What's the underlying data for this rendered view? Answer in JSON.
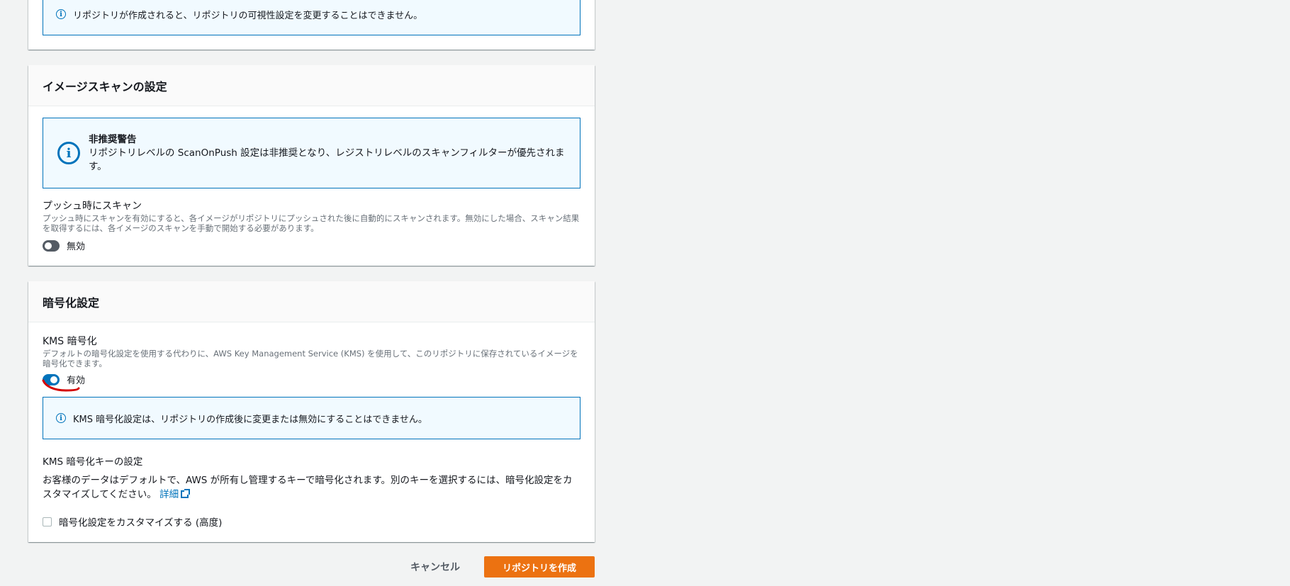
{
  "visibility_notice": {
    "text": "リポジトリが作成されると、リポジトリの可視性設定を変更することはできません。"
  },
  "image_scan": {
    "title": "イメージスキャンの設定",
    "deprecation_alert": {
      "heading": "非推奨警告",
      "body": "リポジトリレベルの ScanOnPush 設定は非推奨となり、レジストリレベルのスキャンフィルターが優先されます。"
    },
    "scan_on_push": {
      "label": "プッシュ時にスキャン",
      "description": "プッシュ時にスキャンを有効にすると、各イメージがリポジトリにプッシュされた後に自動的にスキャンされます。無効にした場合、スキャン結果を取得するには、各イメージのスキャンを手動で開始する必要があります。",
      "state_label": "無効",
      "enabled": false
    }
  },
  "encryption": {
    "title": "暗号化設定",
    "kms": {
      "label": "KMS 暗号化",
      "description": "デフォルトの暗号化設定を使用する代わりに、AWS Key Management Service (KMS) を使用して、このリポジトリに保存されているイメージを暗号化できます。",
      "state_label": "有効",
      "enabled": true
    },
    "kms_notice": "KMS 暗号化設定は、リポジトリの作成後に変更または無効にすることはできません。",
    "key_settings": {
      "label": "KMS 暗号化キーの設定",
      "description": "お客様のデータはデフォルトで、AWS が所有し管理するキーで暗号化されます。別のキーを選択するには、暗号化設定をカスタマイズしてください。",
      "link_label": "詳細"
    },
    "customize_checkbox": {
      "label": "暗号化設定をカスタマイズする (高度)",
      "checked": false
    }
  },
  "actions": {
    "cancel_label": "キャンセル",
    "create_label": "リポジトリを作成"
  },
  "colors": {
    "primary": "#ec7211",
    "info": "#0073bb",
    "annotation": "#d40000"
  }
}
